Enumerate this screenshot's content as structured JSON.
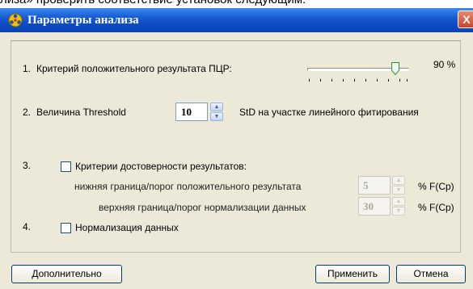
{
  "background": {
    "partial_text": "лиза» проверить соответствие установок следующим:"
  },
  "window": {
    "title": "Параметры анализа",
    "close_glyph": "X"
  },
  "criterion1": {
    "number": "1.",
    "label": "Критерий положительного результата ПЦР:",
    "slider_value": 90,
    "value_text": "90 %"
  },
  "threshold": {
    "number": "2.",
    "label": "Величина Threshold",
    "value": "10",
    "suffix": "StD на участке линейного фитирования"
  },
  "reliability": {
    "number": "3.",
    "checkbox_label": "Критерии достоверности результатов:",
    "checked": false,
    "lower_label": "нижняя граница/порог положительного результата",
    "lower_value": "5",
    "lower_unit": "% F(Cp)",
    "upper_label": "верхняя граница/порог нормализации данных",
    "upper_value": "30",
    "upper_unit": "% F(Cp)"
  },
  "normalization": {
    "number": "4.",
    "checkbox_label": "Нормализация данных",
    "checked": false
  },
  "buttons": {
    "advanced": "Дополнительно",
    "apply": "Применить",
    "cancel": "Отмена"
  },
  "colors": {
    "titlebar": "#0b4ac4",
    "dialog_bg": "#ece9d8",
    "close_button": "#c9452a",
    "button_border": "#003c74"
  }
}
